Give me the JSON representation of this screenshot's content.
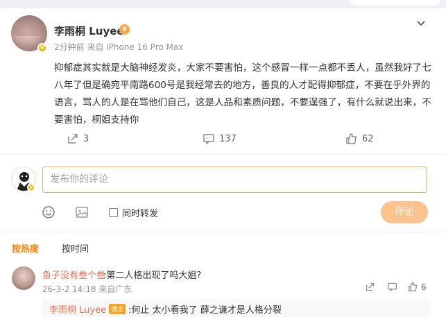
{
  "post": {
    "username": "李雨桐 Luyee",
    "meta": "2分钟前 来自 iPhone 16 Pro Max",
    "text": "抑郁症其实就是大脑神经发炎，大家不要害怕，这个感冒一样一点都不丢人，虽然我好了七八年了但是确宛平南路600号是我经常去的地方，善良的人才配得抑郁症，不要在乎外界的语言，骂人的人是在骂他们自己，这是人品和素质问题，不要逞强了，有什么就说出来，不要害怕，桐姐支持你",
    "repost_count": "3",
    "comment_count": "137",
    "like_count": "62"
  },
  "composer": {
    "placeholder": "发布你的评论",
    "repost_label": "同时转发",
    "submit_label": "评论"
  },
  "sort": {
    "hot_label": "按热度",
    "time_label": "按时间"
  },
  "comment": {
    "username": "鱼子没有叁个叁",
    "text": ":第二人格出现了吗大姐?",
    "meta": "26-3-2 14:18 来自广东",
    "like_count": "6"
  },
  "reply": {
    "username": "李雨桐 Luyee",
    "tag": "博主",
    "text": ":何止 太小看我了 薛之谦才是人格分裂"
  },
  "colors": {
    "accent": "#ff8200",
    "username_link": "#eb7350",
    "submit_disabled": "#fcc38e",
    "input_border": "#f0a85a"
  }
}
